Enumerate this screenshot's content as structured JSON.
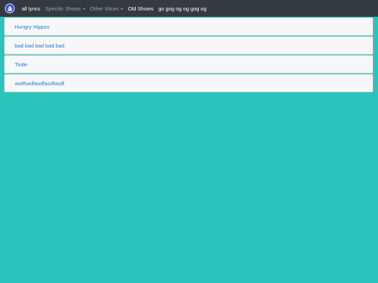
{
  "navbar": {
    "brand_icon": "hand-logo-icon",
    "links": [
      {
        "label": "all lyrics"
      },
      {
        "label": "Specific Shows"
      },
      {
        "label": "Other Stices"
      },
      {
        "label": "Old Shows"
      },
      {
        "label": "go gog og og gog og"
      }
    ]
  },
  "items": [
    {
      "label": "Hungry Hippos"
    },
    {
      "label": "bad bad bad bad bad"
    },
    {
      "label": "Tiotle"
    },
    {
      "label": "asdfsadfasdfasdfasdf"
    }
  ],
  "colors": {
    "background": "#2bc3bc",
    "navbar": "#343a40",
    "link": "#1e7be0"
  }
}
